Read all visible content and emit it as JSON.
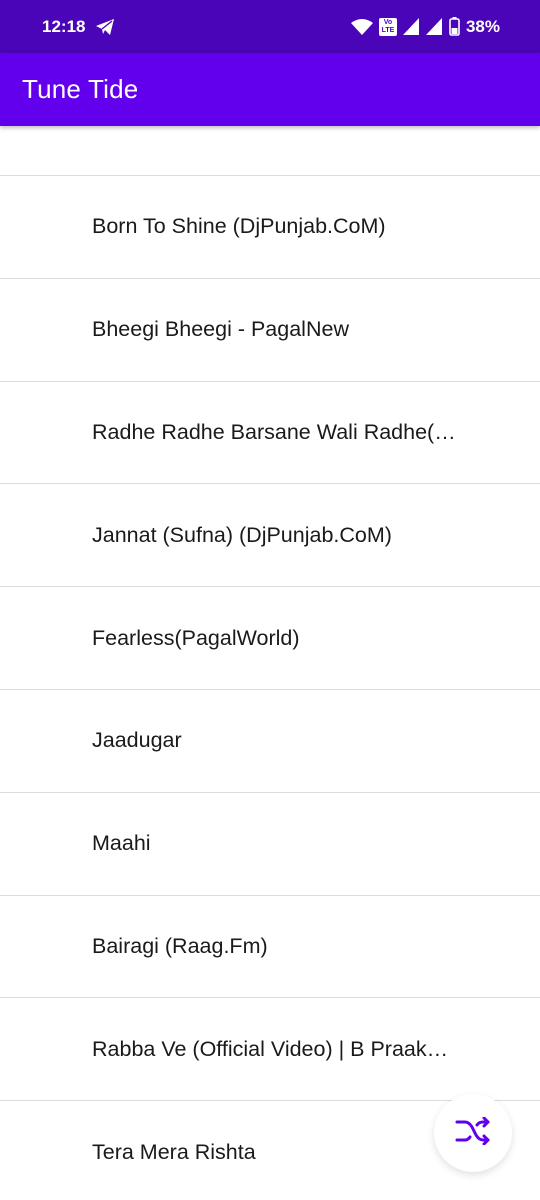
{
  "status_bar": {
    "time": "12:18",
    "battery": "38%",
    "lte_top": "Vo",
    "lte_bottom": "LTE",
    "lte_num": "2"
  },
  "app_bar": {
    "title": "Tune Tide",
    "color": "#6200ee"
  },
  "songs": [
    "Born To Shine (DjPunjab.CoM)",
    "Bheegi Bheegi - PagalNew",
    "Radhe Radhe Barsane Wali Radhe(…",
    "Jannat (Sufna) (DjPunjab.CoM)",
    "Fearless(PagalWorld)",
    "Jaadugar",
    "Maahi",
    "Bairagi (Raag.Fm)",
    "Rabba Ve (Official Video) | B Praak…",
    "Tera Mera Rishta"
  ],
  "icons": {
    "telegram": "telegram-icon",
    "wifi": "wifi-icon",
    "signal": "signal-icon",
    "battery": "battery-icon",
    "shuffle": "shuffle-icon"
  },
  "accent_color": "#6200ee"
}
